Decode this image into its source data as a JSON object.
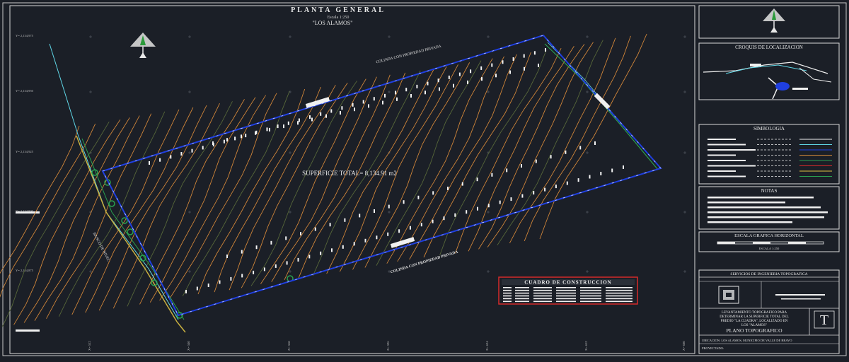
{
  "header": {
    "title": "PLANTA GENERAL",
    "scale": "Escala 1:250",
    "subtitle": "\"LOS ALAMOS\""
  },
  "plan": {
    "area_label": "SUPERFICIE TOTAL= 8,134.91 m2",
    "road_top": "COLINDA CON PROPIEDAD PRIVADA",
    "road_bottom": "COLINDA CON PROPIEDAD PRIVADA",
    "road_left": "BANCO DE NIVEL"
  },
  "grid": {
    "y_labels": [
      "Y= 2,134,975",
      "Y= 2,134,950",
      "Y= 2,134,925",
      "Y= 2,134,900",
      "Y= 2,134,875"
    ],
    "x_labels": [
      "X= 512",
      "X= 540",
      "X= 568",
      "X= 596",
      "X= 624",
      "X= 652",
      "X= 680"
    ]
  },
  "construction_table": {
    "title": "CUADRO DE CONSTRUCCION"
  },
  "panels": {
    "location": "CROQUIS DE LOCALIZACION",
    "symbology": "SIMBOLOGIA",
    "notes": "NOTAS",
    "graphic_scale": "ESCALA GRAFICA HORIZONTAL",
    "graphic_scale_sub": "ESCALA 1:250",
    "company": "SERVICIOS DE INGENIERIA TOPOGRAFICA",
    "description": [
      "LEVANTAMIENTO TOPOGRAFICO PARA",
      "DETERMINAR LA SUPERFICIE TOTAL DEL",
      "PREDIO \"LA CUADRA\", LOCALIZADO EN",
      "LOS \"ALAMOS\""
    ],
    "plan_type": "PLANO TOPOGRAFICO",
    "location_line": "UBICACION: LOS ALAMOS, MUNICIPIO DE VALLE DE BRAVO",
    "project_line": "PROYECTADO:",
    "logo_letter": "T"
  },
  "colors": {
    "background": "#1b1f27",
    "boundary": "#1f3fe0",
    "contour": "#d88a3a",
    "contour_dark": "#5a6a3a",
    "table_border": "#d42a2a",
    "cyan": "#5fd6e6"
  }
}
